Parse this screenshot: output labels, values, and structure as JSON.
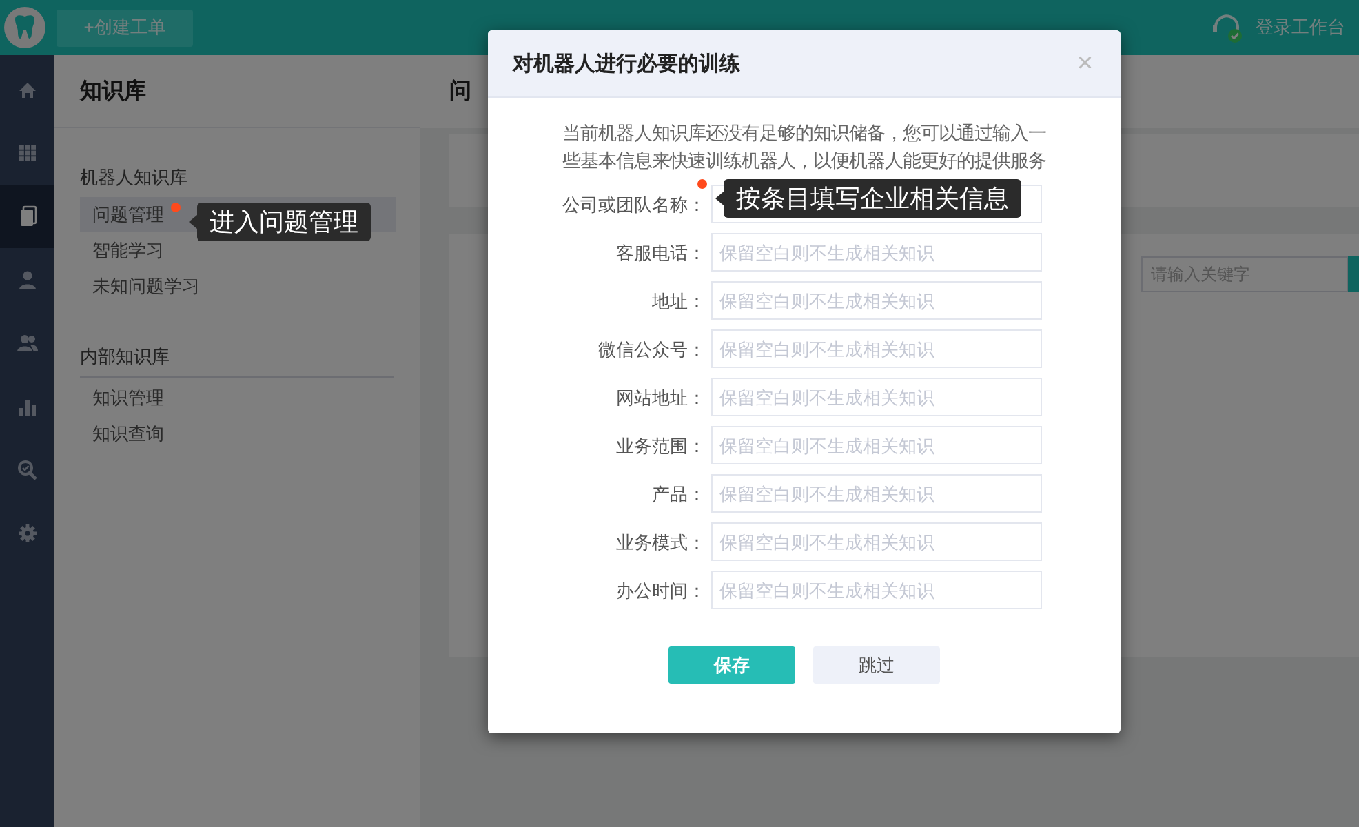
{
  "top_bar": {
    "create_button": "+创建工单",
    "workbench_link": "登录工作台"
  },
  "rail": [
    {
      "kind": "home",
      "selected": false
    },
    {
      "kind": "grid",
      "selected": false
    },
    {
      "kind": "book",
      "selected": true
    },
    {
      "kind": "user",
      "selected": false
    },
    {
      "kind": "users",
      "selected": false
    },
    {
      "kind": "chart",
      "selected": false
    },
    {
      "kind": "search",
      "selected": false
    },
    {
      "kind": "settings",
      "selected": false
    }
  ],
  "sidebar": {
    "title": "知识库",
    "groups": [
      {
        "title": "机器人知识库",
        "items": [
          {
            "label": "问题管理",
            "selected": true
          },
          {
            "label": "智能学习",
            "selected": false
          },
          {
            "label": "未知问题学习",
            "selected": false
          }
        ]
      },
      {
        "title": "内部知识库",
        "items": [
          {
            "label": "知识管理",
            "selected": false
          },
          {
            "label": "知识查询",
            "selected": false
          }
        ]
      }
    ]
  },
  "main": {
    "title": "问",
    "search": {
      "placeholder": "请输入关键字"
    }
  },
  "dialog": {
    "title": "对机器人进行必要的训练",
    "close": "×",
    "description": "当前机器人知识库还没有足够的知识储备，您可以通过输入一些基本信息来快速训练机器人，以便机器人能更好的提供服务",
    "fields": [
      {
        "label": "公司或团队名称："
      },
      {
        "label": "客服电话：",
        "placeholder": "保留空白则不生成相关知识"
      },
      {
        "label": "地址：",
        "placeholder": "保留空白则不生成相关知识"
      },
      {
        "label": "微信公众号：",
        "placeholder": "保留空白则不生成相关知识"
      },
      {
        "label": "网站地址：",
        "placeholder": "保留空白则不生成相关知识"
      },
      {
        "label": "业务范围：",
        "placeholder": "保留空白则不生成相关知识"
      },
      {
        "label": "产品：",
        "placeholder": "保留空白则不生成相关知识"
      },
      {
        "label": "业务模式：",
        "placeholder": "保留空白则不生成相关知识"
      },
      {
        "label": "办公时间：",
        "placeholder": "保留空白则不生成相关知识"
      }
    ],
    "buttons": [
      {
        "label": "保存",
        "kind": "primary"
      },
      {
        "label": "跳过",
        "kind": "secondary"
      }
    ]
  },
  "annotations": [
    {
      "text": "进入问题管理"
    },
    {
      "text": "按条目填写企业相关信息"
    }
  ]
}
